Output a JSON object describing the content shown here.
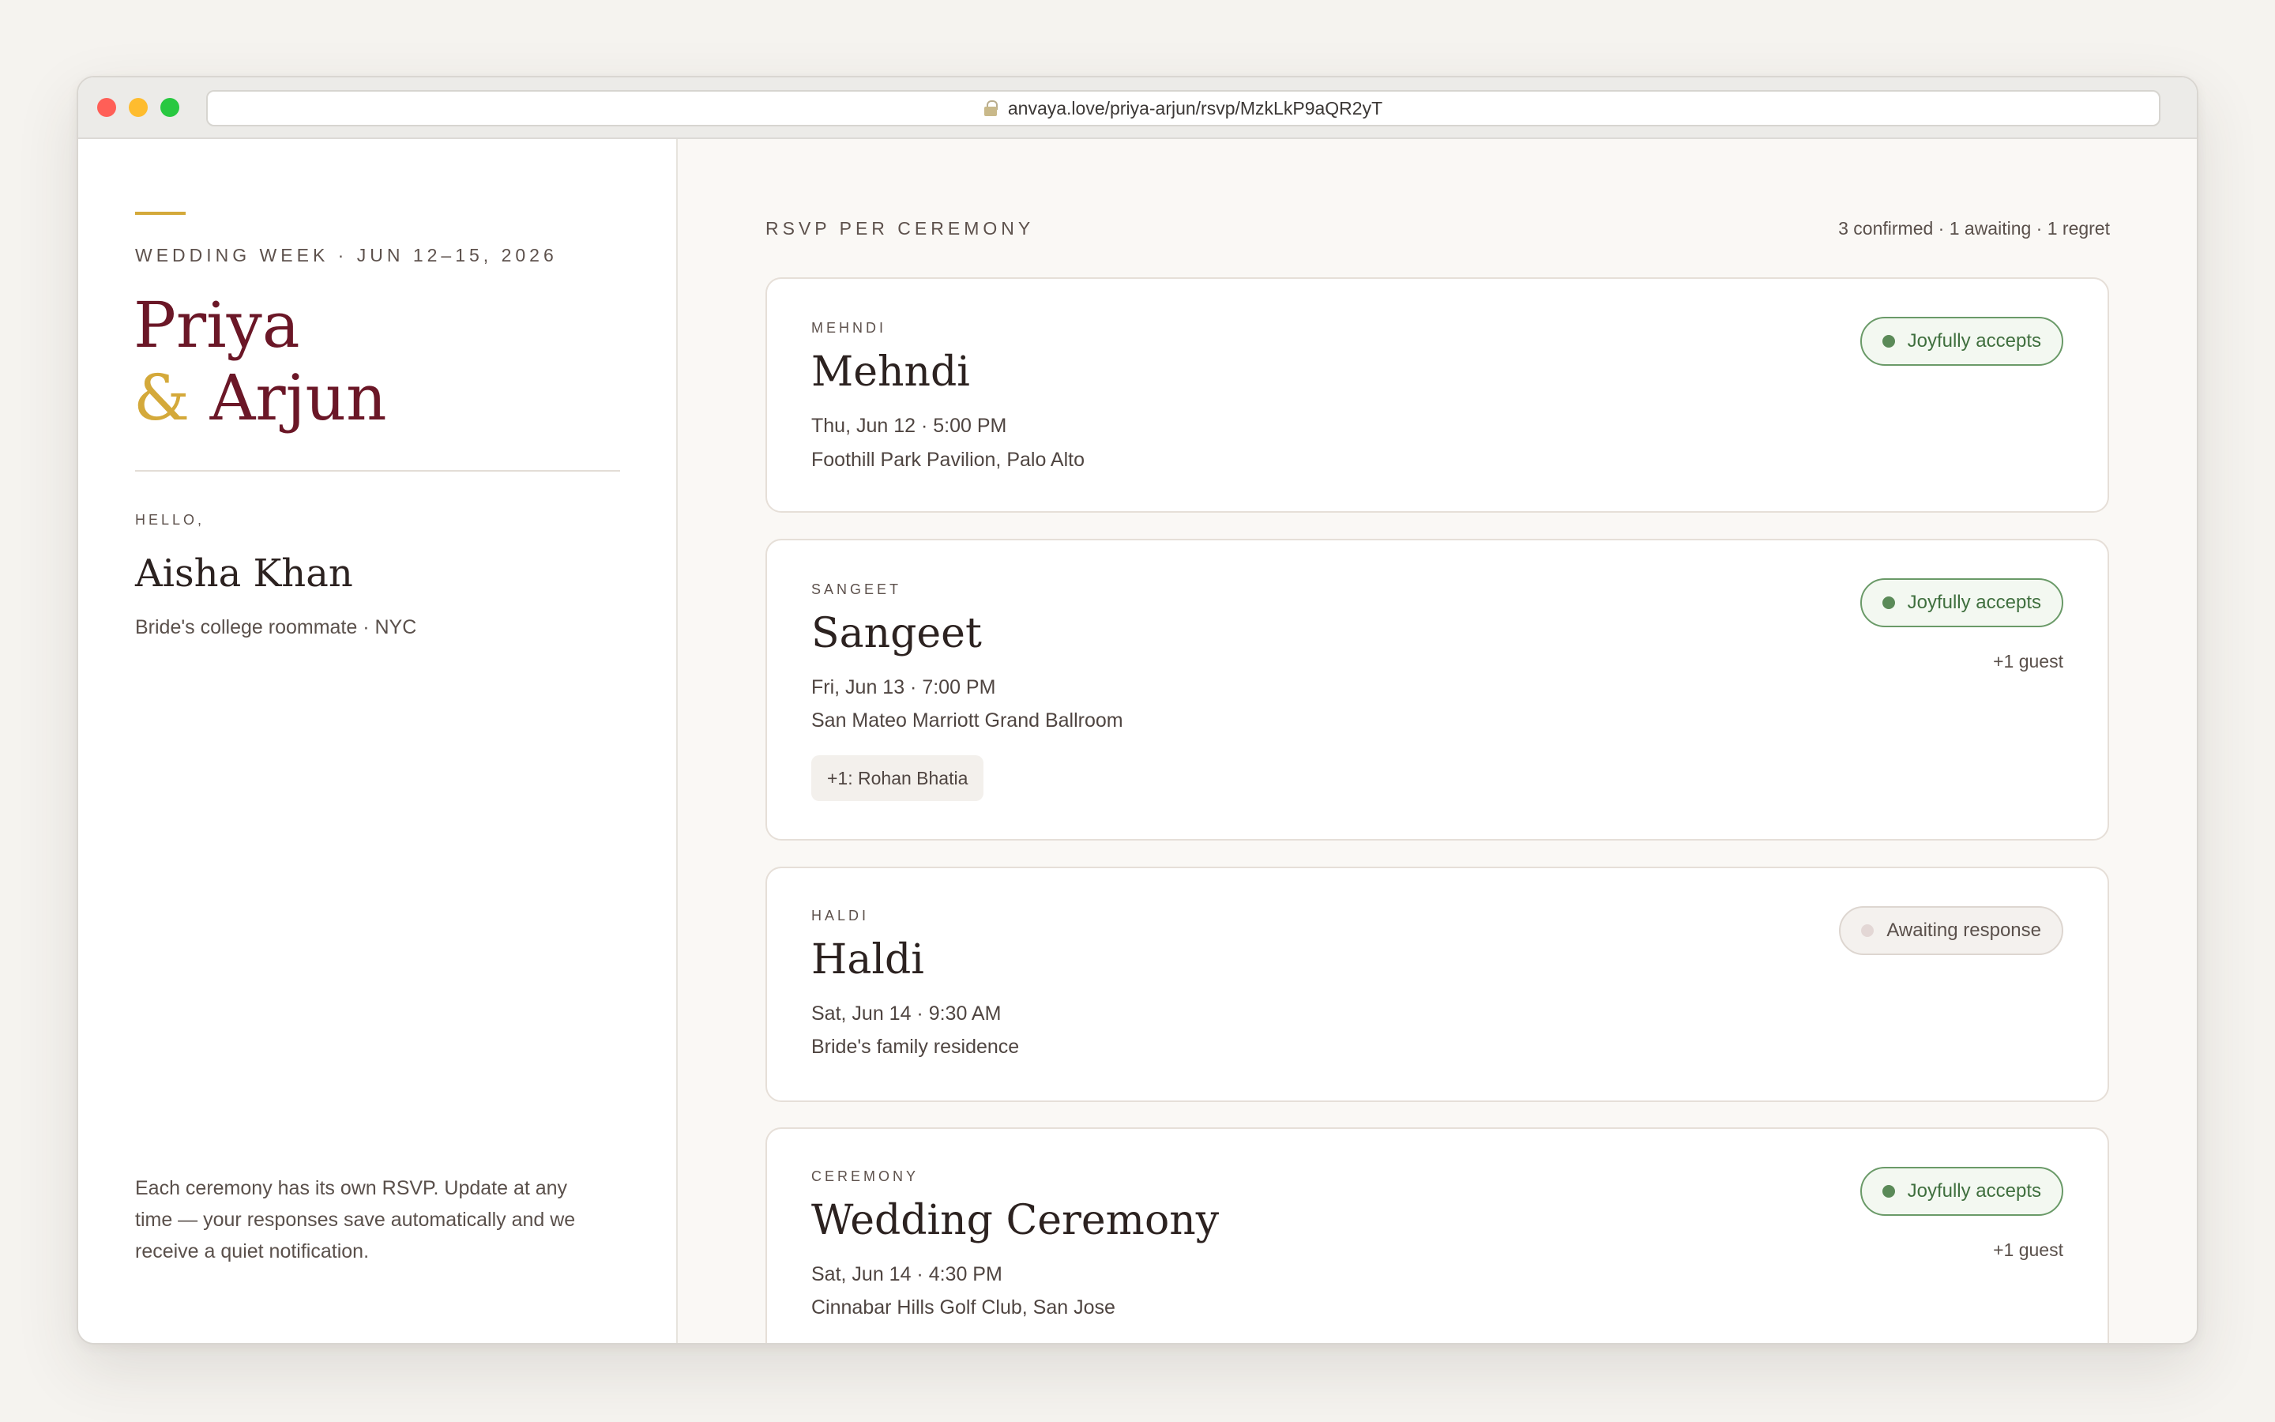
{
  "browser": {
    "url": "anvaya.love/priya-arjun/rsvp/MzkLkP9aQR2yT"
  },
  "sidebar": {
    "eyebrow": "WEDDING WEEK · JUN 12–15, 2026",
    "couple_first": "Priya",
    "ampersand": "&",
    "couple_second": "Arjun",
    "greeting": "HELLO,",
    "guest_name": "Aisha Khan",
    "guest_relation": "Bride's college roommate · NYC",
    "footnote": "Each ceremony has its own RSVP. Update at any time — your responses save automatically and we receive a quiet notification."
  },
  "main": {
    "heading": "RSVP PER CEREMONY",
    "summary": "3 confirmed · 1 awaiting · 1 regret",
    "ceremonies": [
      {
        "tag": "MEHNDI",
        "title": "Mehndi",
        "when": "Thu, Jun 12 · 5:00 PM",
        "where": "Foothill Park Pavilion, Palo Alto",
        "status": "Joyfully accepts"
      },
      {
        "tag": "SANGEET",
        "title": "Sangeet",
        "when": "Fri, Jun 13 · 7:00 PM",
        "where": "San Mateo Marriott Grand Ballroom",
        "status": "Joyfully accepts",
        "plus_guest": "+1 guest",
        "plus_one": "+1: Rohan Bhatia"
      },
      {
        "tag": "HALDI",
        "title": "Haldi",
        "when": "Sat, Jun 14 · 9:30 AM",
        "where": "Bride's family residence",
        "status": "Awaiting response"
      },
      {
        "tag": "CEREMONY",
        "title": "Wedding Ceremony",
        "when": "Sat, Jun 14 · 4:30 PM",
        "where": "Cinnabar Hills Golf Club, San Jose",
        "status": "Joyfully accepts",
        "plus_guest": "+1 guest"
      }
    ]
  },
  "colors": {
    "burgundy": "#6b1727",
    "gold": "#d4a93a",
    "accept_green": "#3f6f3e",
    "background": "#f5f3ef"
  }
}
